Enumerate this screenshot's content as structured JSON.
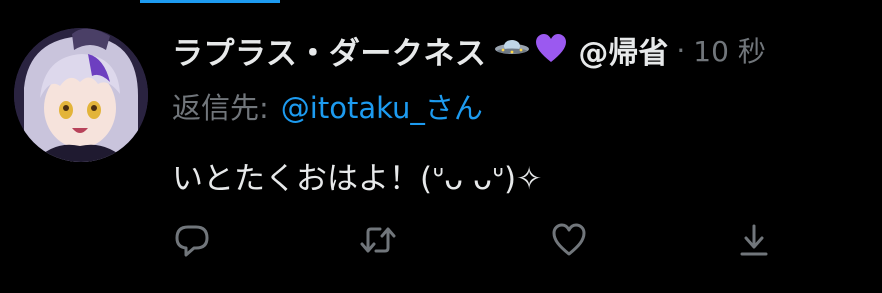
{
  "tweet": {
    "display_name": "ラプラス・ダークネス",
    "emoji_1": "ufo-emoji",
    "emoji_2": "purple-heart-emoji",
    "handle": "@帰省",
    "separator": "·",
    "timestamp": "10 秒",
    "reply_label": "返信先:",
    "reply_to": "@itotaku_さん",
    "text": "いとたくおはよ！(ᐡᴗ ᴗᐡ)✧"
  },
  "actions": [
    {
      "name": "reply",
      "icon": "reply-icon"
    },
    {
      "name": "retweet",
      "icon": "retweet-icon"
    },
    {
      "name": "like",
      "icon": "heart-icon"
    },
    {
      "name": "share",
      "icon": "share-icon"
    }
  ],
  "colors": {
    "background": "#000000",
    "primary_text": "#e7e9ea",
    "secondary_text": "#71767b",
    "accent": "#1d9bf0",
    "heart": "#9b59f0"
  }
}
